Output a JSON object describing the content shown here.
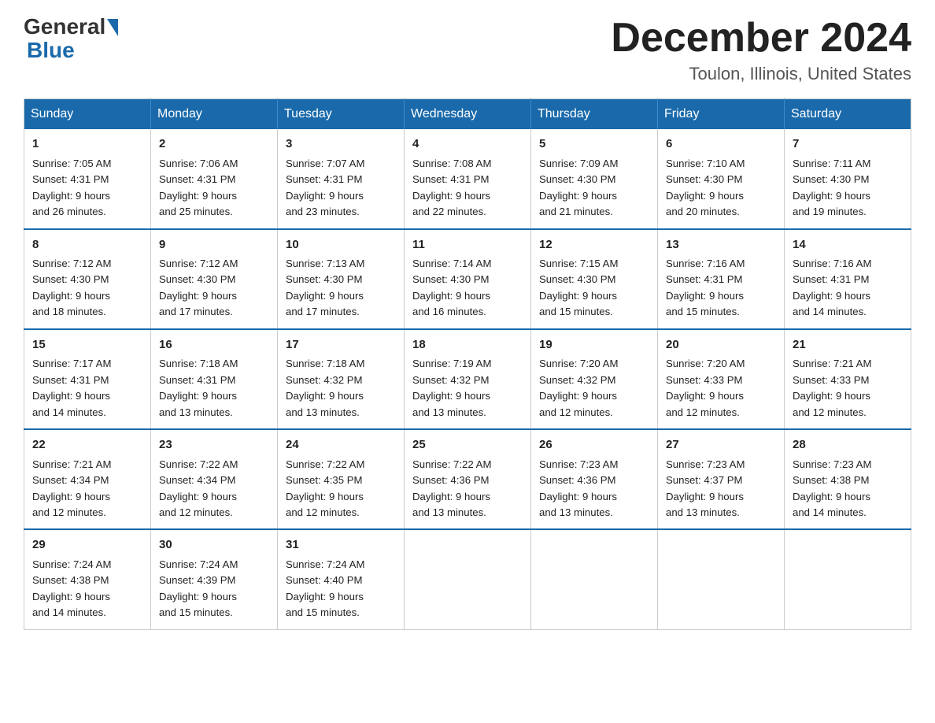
{
  "header": {
    "logo_general": "General",
    "logo_blue": "Blue",
    "month_title": "December 2024",
    "location": "Toulon, Illinois, United States"
  },
  "weekdays": [
    "Sunday",
    "Monday",
    "Tuesday",
    "Wednesday",
    "Thursday",
    "Friday",
    "Saturday"
  ],
  "weeks": [
    [
      {
        "day": "1",
        "sunrise": "7:05 AM",
        "sunset": "4:31 PM",
        "daylight": "9 hours and 26 minutes."
      },
      {
        "day": "2",
        "sunrise": "7:06 AM",
        "sunset": "4:31 PM",
        "daylight": "9 hours and 25 minutes."
      },
      {
        "day": "3",
        "sunrise": "7:07 AM",
        "sunset": "4:31 PM",
        "daylight": "9 hours and 23 minutes."
      },
      {
        "day": "4",
        "sunrise": "7:08 AM",
        "sunset": "4:31 PM",
        "daylight": "9 hours and 22 minutes."
      },
      {
        "day": "5",
        "sunrise": "7:09 AM",
        "sunset": "4:30 PM",
        "daylight": "9 hours and 21 minutes."
      },
      {
        "day": "6",
        "sunrise": "7:10 AM",
        "sunset": "4:30 PM",
        "daylight": "9 hours and 20 minutes."
      },
      {
        "day": "7",
        "sunrise": "7:11 AM",
        "sunset": "4:30 PM",
        "daylight": "9 hours and 19 minutes."
      }
    ],
    [
      {
        "day": "8",
        "sunrise": "7:12 AM",
        "sunset": "4:30 PM",
        "daylight": "9 hours and 18 minutes."
      },
      {
        "day": "9",
        "sunrise": "7:12 AM",
        "sunset": "4:30 PM",
        "daylight": "9 hours and 17 minutes."
      },
      {
        "day": "10",
        "sunrise": "7:13 AM",
        "sunset": "4:30 PM",
        "daylight": "9 hours and 17 minutes."
      },
      {
        "day": "11",
        "sunrise": "7:14 AM",
        "sunset": "4:30 PM",
        "daylight": "9 hours and 16 minutes."
      },
      {
        "day": "12",
        "sunrise": "7:15 AM",
        "sunset": "4:30 PM",
        "daylight": "9 hours and 15 minutes."
      },
      {
        "day": "13",
        "sunrise": "7:16 AM",
        "sunset": "4:31 PM",
        "daylight": "9 hours and 15 minutes."
      },
      {
        "day": "14",
        "sunrise": "7:16 AM",
        "sunset": "4:31 PM",
        "daylight": "9 hours and 14 minutes."
      }
    ],
    [
      {
        "day": "15",
        "sunrise": "7:17 AM",
        "sunset": "4:31 PM",
        "daylight": "9 hours and 14 minutes."
      },
      {
        "day": "16",
        "sunrise": "7:18 AM",
        "sunset": "4:31 PM",
        "daylight": "9 hours and 13 minutes."
      },
      {
        "day": "17",
        "sunrise": "7:18 AM",
        "sunset": "4:32 PM",
        "daylight": "9 hours and 13 minutes."
      },
      {
        "day": "18",
        "sunrise": "7:19 AM",
        "sunset": "4:32 PM",
        "daylight": "9 hours and 13 minutes."
      },
      {
        "day": "19",
        "sunrise": "7:20 AM",
        "sunset": "4:32 PM",
        "daylight": "9 hours and 12 minutes."
      },
      {
        "day": "20",
        "sunrise": "7:20 AM",
        "sunset": "4:33 PM",
        "daylight": "9 hours and 12 minutes."
      },
      {
        "day": "21",
        "sunrise": "7:21 AM",
        "sunset": "4:33 PM",
        "daylight": "9 hours and 12 minutes."
      }
    ],
    [
      {
        "day": "22",
        "sunrise": "7:21 AM",
        "sunset": "4:34 PM",
        "daylight": "9 hours and 12 minutes."
      },
      {
        "day": "23",
        "sunrise": "7:22 AM",
        "sunset": "4:34 PM",
        "daylight": "9 hours and 12 minutes."
      },
      {
        "day": "24",
        "sunrise": "7:22 AM",
        "sunset": "4:35 PM",
        "daylight": "9 hours and 12 minutes."
      },
      {
        "day": "25",
        "sunrise": "7:22 AM",
        "sunset": "4:36 PM",
        "daylight": "9 hours and 13 minutes."
      },
      {
        "day": "26",
        "sunrise": "7:23 AM",
        "sunset": "4:36 PM",
        "daylight": "9 hours and 13 minutes."
      },
      {
        "day": "27",
        "sunrise": "7:23 AM",
        "sunset": "4:37 PM",
        "daylight": "9 hours and 13 minutes."
      },
      {
        "day": "28",
        "sunrise": "7:23 AM",
        "sunset": "4:38 PM",
        "daylight": "9 hours and 14 minutes."
      }
    ],
    [
      {
        "day": "29",
        "sunrise": "7:24 AM",
        "sunset": "4:38 PM",
        "daylight": "9 hours and 14 minutes."
      },
      {
        "day": "30",
        "sunrise": "7:24 AM",
        "sunset": "4:39 PM",
        "daylight": "9 hours and 15 minutes."
      },
      {
        "day": "31",
        "sunrise": "7:24 AM",
        "sunset": "4:40 PM",
        "daylight": "9 hours and 15 minutes."
      },
      null,
      null,
      null,
      null
    ]
  ],
  "labels": {
    "sunrise": "Sunrise:",
    "sunset": "Sunset:",
    "daylight": "Daylight:"
  }
}
